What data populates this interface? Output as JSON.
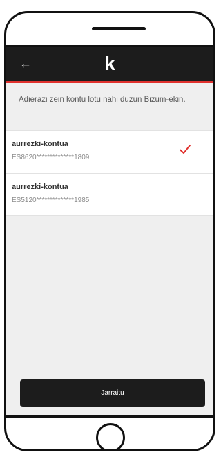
{
  "header": {
    "back_icon": "back-arrow-icon",
    "logo": "k"
  },
  "instruction": "Adierazi zein kontu lotu nahi duzun Bizum-ekin.",
  "accounts": [
    {
      "name": "aurrezki-kontua",
      "number": "ES8620**************1809",
      "selected": true
    },
    {
      "name": "aurrezki-kontua",
      "number": "ES5120**************1985",
      "selected": false
    }
  ],
  "continue_label": "Jarraitu",
  "colors": {
    "dark": "#1c1c1c",
    "accent": "#e0312e",
    "background": "#efefef"
  }
}
